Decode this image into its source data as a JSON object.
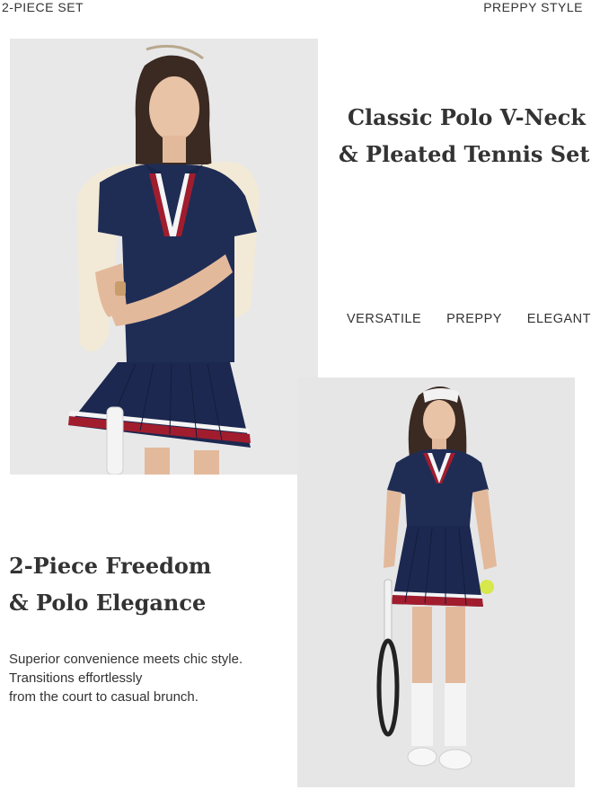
{
  "top": {
    "left_label": "2-PIECE SET",
    "right_label": "PREPPY STYLE"
  },
  "headline_1": {
    "line1": "Classic Polo V-Neck",
    "line2": "& Pleated Tennis Set"
  },
  "tags": [
    "VERSATILE",
    "PREPPY",
    "ELEGANT"
  ],
  "headline_2": {
    "line1": "2-Piece Freedom",
    "line2": "& Polo Elegance"
  },
  "body": {
    "line1": "Superior convenience meets chic style.",
    "line2": "Transitions effortlessly",
    "line3": "from the court to casual brunch."
  },
  "colors": {
    "navy": "#1f2d55",
    "red": "#a11d2e",
    "cream": "#f2ead6",
    "background": "#e9e9ea"
  }
}
